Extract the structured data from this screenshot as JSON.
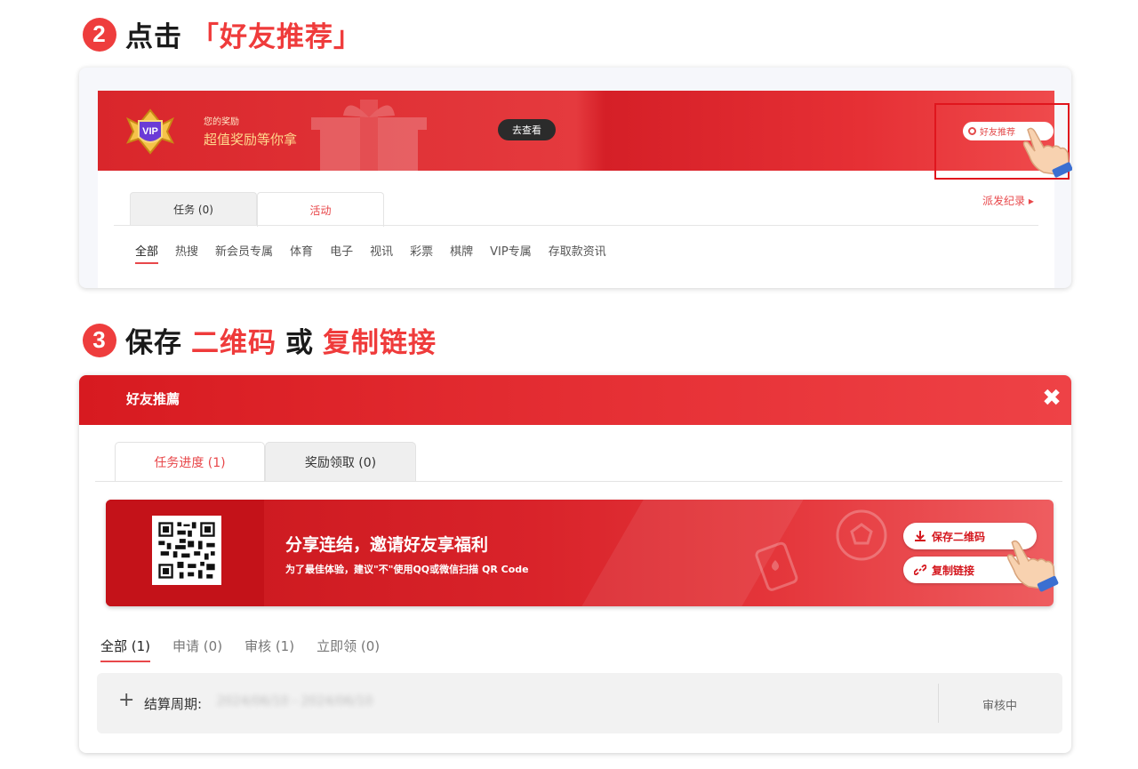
{
  "step2": {
    "num": "2",
    "text_black": "点击",
    "text_red": "「好友推荐」"
  },
  "step3": {
    "num": "3",
    "text1": "保存",
    "text2": "二维码",
    "text3": "或",
    "text4": "复制链接"
  },
  "banner": {
    "small_label": "您的奖励",
    "big_label": "超值奖励等你拿",
    "go_view": "去查看",
    "friend_btn": "好友推荐",
    "vip_text": "VIP"
  },
  "tabs1": [
    "任务 (0)",
    "活动"
  ],
  "record_link": "派发纪录 ▸",
  "categories": [
    "全部",
    "热搜",
    "新会员专属",
    "体育",
    "电子",
    "视讯",
    "彩票",
    "棋牌",
    "VIP专属",
    "存取款资讯"
  ],
  "dialog": {
    "title": "好友推薦",
    "tabs": [
      "任务进度 (1)",
      "奖励领取 (0)"
    ],
    "share_title": "分享连结，邀请好友享福利",
    "share_sub": "为了最佳体验，建议\"不\"使用QQ或微信扫描 QR Code",
    "save_qr": "保存二维码",
    "copy_link": "复制链接",
    "filters": [
      "全部 (1)",
      "申请 (0)",
      "审核 (1)",
      "立即领 (0)"
    ],
    "row": {
      "period_label": "结算周期:",
      "period_value": "2024/06/10 - 2024/06/10",
      "status": "审核中"
    }
  },
  "colors": {
    "accent": "#ee3d3d",
    "banner_red": "#e1282d",
    "highlight_box": "#e0151d"
  },
  "icons": [
    "close-icon",
    "download-icon",
    "link-icon",
    "gift-icon",
    "vip-badge-icon",
    "pointing-hand-icon",
    "plus-icon"
  ]
}
